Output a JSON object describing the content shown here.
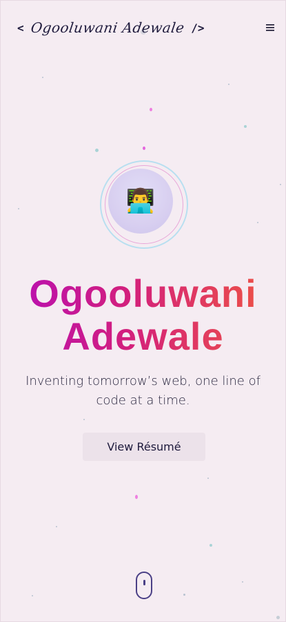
{
  "header": {
    "logo_open": "<",
    "logo_name": "Ogooluwani Adewale",
    "logo_close": "/>",
    "menu_icon": "hamburger-menu-icon"
  },
  "hero": {
    "avatar_icon": "technologist-emoji",
    "avatar_emoji": "👨‍💻",
    "name_line1": "Ogooluwani",
    "name_line2": "Adewale",
    "tagline_line1": "Inventing tomorrow’s web, one line of",
    "tagline_line2": "code at a time.",
    "resume_button": "View Résumé"
  },
  "scroll_indicator": {
    "icon": "mouse-scroll-icon"
  },
  "colors": {
    "background": "#f5ecf2",
    "gradient_start": "#b50db8",
    "gradient_mid": "#d3207c",
    "gradient_end": "#f0583f",
    "text_dark": "#1e1a3c",
    "accent_purple": "#4a3f86"
  }
}
